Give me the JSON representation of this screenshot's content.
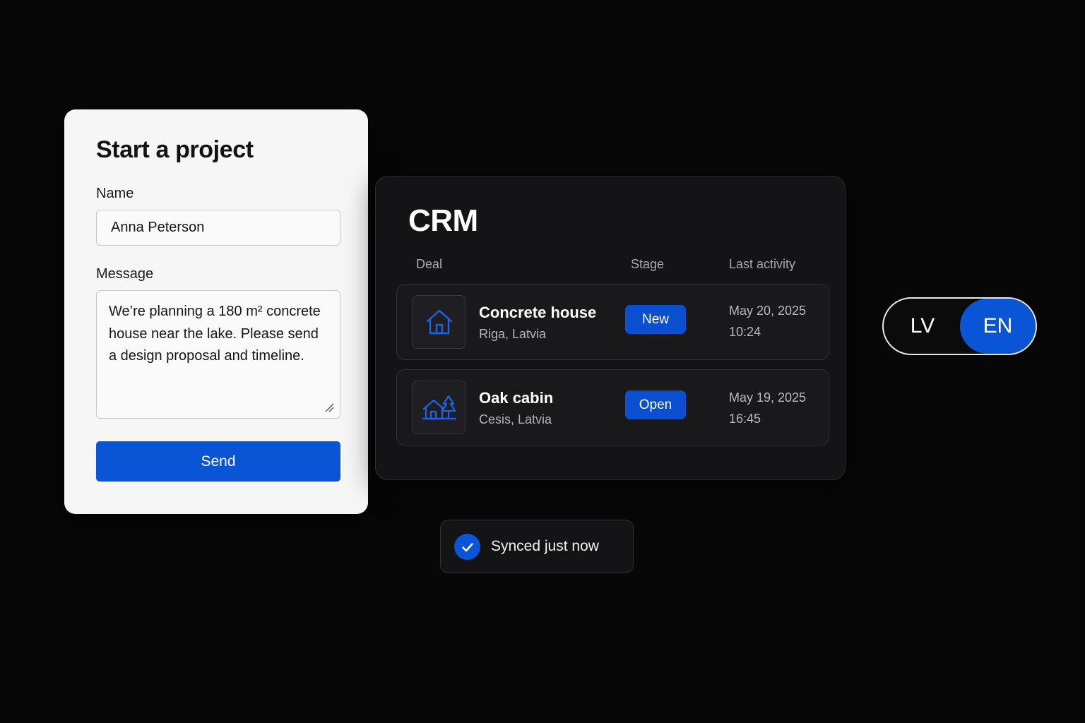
{
  "form": {
    "title": "Start a project",
    "name_label": "Name",
    "name_value": "Anna Peterson",
    "message_label": "Message",
    "message_value": "We’re planning a 180 m² concrete house near the lake. Please send a design proposal and timeline.",
    "send_label": "Send"
  },
  "crm": {
    "title": "CRM",
    "columns": {
      "deal": "Deal",
      "stage": "Stage",
      "last_activity": "Last activity"
    },
    "deals": [
      {
        "name": "Concrete house",
        "location": "Riga, Latvia",
        "stage": "New",
        "date": "May 20, 2025",
        "time": "10:24",
        "icon": "house-icon"
      },
      {
        "name": "Oak cabin",
        "location": "Cesis, Latvia",
        "stage": "Open",
        "date": "May 19, 2025",
        "time": "16:45",
        "icon": "cabin-trees-icon"
      }
    ]
  },
  "language_toggle": {
    "options": [
      "LV",
      "EN"
    ],
    "selected": "EN"
  },
  "sync_status": {
    "text": "Synced just now",
    "icon": "check-icon"
  },
  "colors": {
    "accent": "#0a55d6",
    "background": "#070707",
    "form_card": "#f6f6f7",
    "panel": "#141416"
  }
}
